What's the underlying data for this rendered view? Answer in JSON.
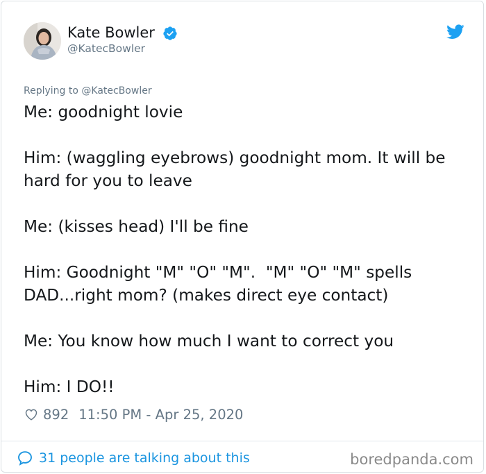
{
  "tweet": {
    "author_name": "Kate Bowler",
    "author_handle": "@KatecBowler",
    "replying_label": "Replying to",
    "replying_to": "@KatecBowler",
    "text": "Me: goodnight lovie\n\nHim: (waggling eyebrows) goodnight mom. It will be hard for you to leave\n\nMe: (kisses head) I'll be fine\n\nHim: Goodnight \"M\" \"O\" \"M\".  \"M\" \"O\" \"M\" spells DAD...right mom? (makes direct eye contact)\n\nMe: You know how much I want to correct you\n\nHim: I DO!!",
    "likes": "892",
    "timestamp": "11:50 PM - Apr 25, 2020"
  },
  "footer": {
    "conversation_text": "31 people are talking about this",
    "watermark": "boredpanda.com"
  },
  "icons": {
    "verified": "verified-badge-icon",
    "platform": "twitter-bird-icon",
    "like": "heart-icon",
    "conversation": "speech-bubble-icon"
  },
  "colors": {
    "accent": "#1da1f2",
    "link": "#1b95e0",
    "muted": "#657786",
    "text": "#14171a"
  }
}
